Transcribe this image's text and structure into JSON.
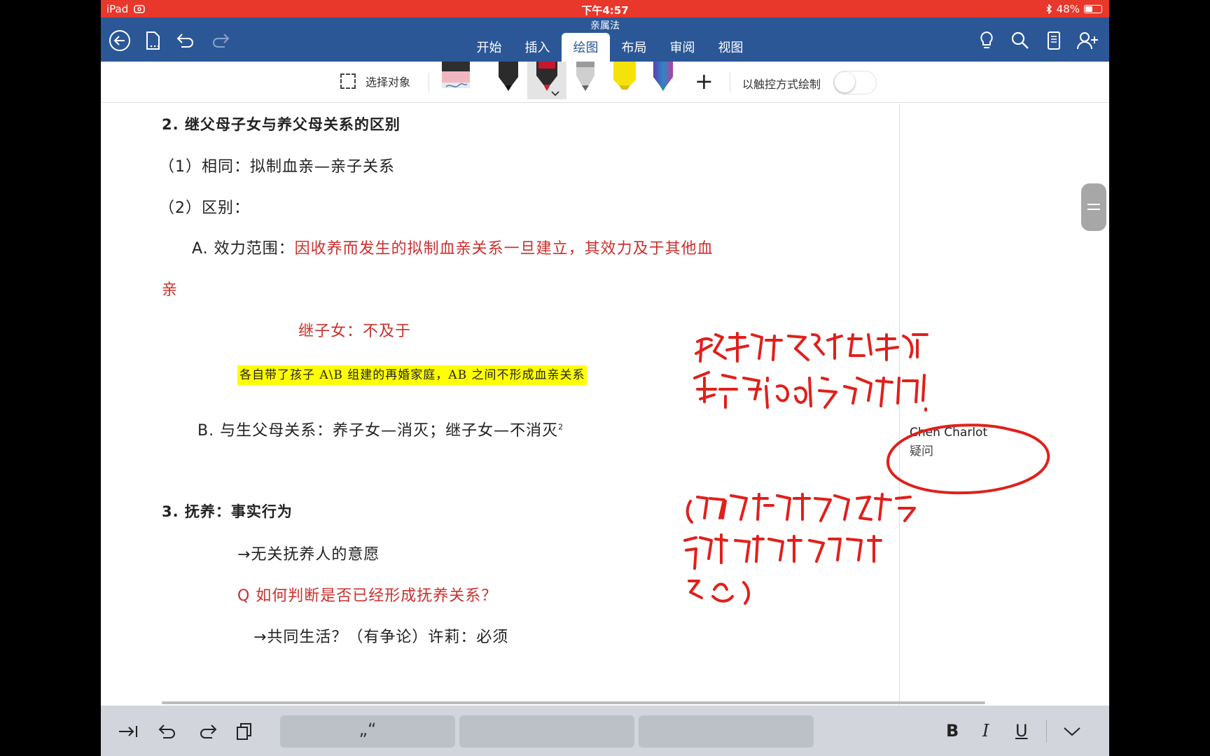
{
  "status_bar": {
    "device": "iPad",
    "time": "下午4:57",
    "battery": "48%",
    "battery_level": 0.48
  },
  "header": {
    "doc_title": "亲属法",
    "tabs": [
      {
        "label": "开始",
        "active": false
      },
      {
        "label": "插入",
        "active": false
      },
      {
        "label": "绘图",
        "active": true
      },
      {
        "label": "布局",
        "active": false
      },
      {
        "label": "审阅",
        "active": false
      },
      {
        "label": "视图",
        "active": false
      }
    ]
  },
  "toolbar": {
    "select_label": "选择对象",
    "touch_draw_label": "以触控方式绘制",
    "touch_draw_on": false
  },
  "document": {
    "h2": "2.  继父母子女与养父母关系的区别",
    "p1": "（1）相同：拟制血亲—亲子关系",
    "p2": "（2）区别：",
    "a_prefix": "A.  效力范围：",
    "a_red": "因收养而发生的拟制血亲关系一旦建立，其效力及于其他血",
    "a_red_cont": "亲",
    "step": "继子女：不及于",
    "highlight": "各自带了孩子 A\\B 组建的再婚家庭，AB 之间不形成血亲关系",
    "b_line": "B.  与生父母关系：养子女—消灭；继子女—不消灭",
    "b_sup": "2",
    "h3": "3.  抚养：事实行为",
    "arrow1": "→无关抚养人的意愿",
    "q": "Q  如何判断是否已经形成抚养关系？",
    "arrow2": "→共同生活？（有争论）许莉：必须"
  },
  "comment": {
    "author": "Chen Charlot",
    "text": "疑问"
  },
  "keyboard_bar": {
    "suggestions": [
      "„“",
      "",
      ""
    ],
    "bold": "B",
    "italic": "I",
    "underline": "U"
  },
  "colors": {
    "status_red": "#e8372b",
    "ribbon_blue": "#2b5797",
    "text_red": "#c9302c",
    "ink_red": "#e0201b",
    "highlight": "#ffff00"
  }
}
